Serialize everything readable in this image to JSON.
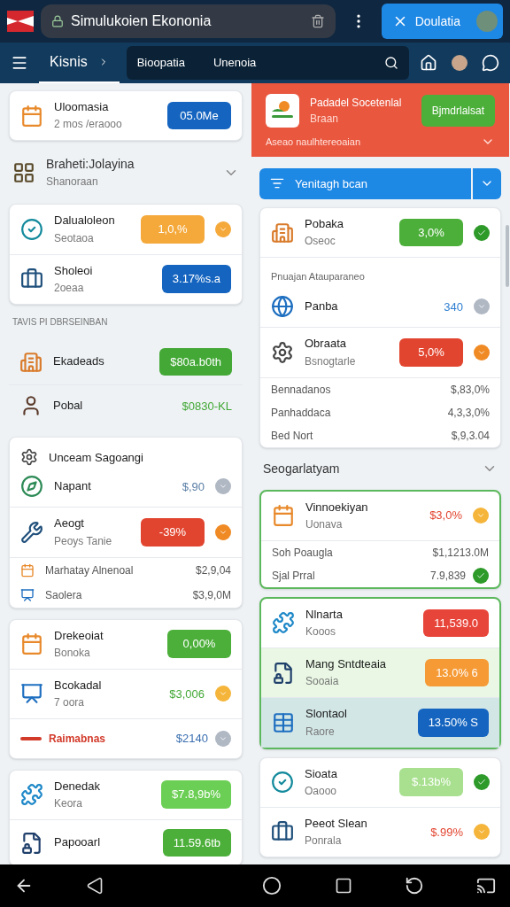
{
  "browser": {
    "title": "Simulukoien Ekononia",
    "action": "Doulatia"
  },
  "nav": {
    "tab": {
      "label": "Kisnis",
      "selected": true
    },
    "search": [
      "Bioopatia",
      "Unenoia"
    ]
  },
  "left": [
    {
      "kind": "card",
      "outlined": false,
      "rows": [
        {
          "kind": "pill",
          "title": "Uloomasia",
          "subtitle": "2 mos /eraooo",
          "value": "05.0Me",
          "color": "#1565c0"
        }
      ]
    },
    {
      "kind": "section",
      "title": "Braheti:Jolayina",
      "subtitle": "Shanoraan"
    },
    {
      "kind": "card",
      "outlined": false,
      "rows": [
        {
          "kind": "pill",
          "title": "Dalualoleon",
          "subtitle": "Seotaoa",
          "value": "1,0,%",
          "color": "#f5a93b",
          "dot": {
            "color": "#f5a93b",
            "check": false
          }
        },
        {
          "kind": "pill",
          "title": "Sholeoi",
          "subtitle": "2oeaa",
          "value": "3.17%s.a",
          "color": "#1565c0"
        }
      ]
    },
    {
      "kind": "label",
      "text": "TAVIS PI DBRSEINBAN"
    },
    {
      "kind": "plain",
      "rows": [
        {
          "kind": "pill",
          "title": "Ekadeads",
          "value": "$80a.b0th",
          "color": "#43a836"
        },
        {
          "kind": "amount",
          "title": "Pobal",
          "value": "$0830-KL",
          "color": "#43a836"
        }
      ]
    },
    {
      "kind": "card",
      "outlined": false,
      "rows": [
        {
          "kind": "heading",
          "title": "Unceam Sagoangi"
        },
        {
          "kind": "amount",
          "title": "Napant",
          "value": "$,90",
          "color": "#5b7fa6",
          "dot": {
            "color": "#b0b8c4",
            "check": false
          }
        },
        {
          "kind": "pill",
          "title": "Aeogt",
          "subtitle": "Peoys Tanie",
          "value": "-39%",
          "color": "#e2452f",
          "dot": {
            "color": "#f08a24",
            "check": false
          }
        },
        {
          "kind": "entry",
          "title": "Marhatay Alnenoal",
          "value": "$2,9,04"
        },
        {
          "kind": "entry",
          "title": "Saolera",
          "value": "$3,9,0M"
        }
      ]
    },
    {
      "kind": "card",
      "outlined": false,
      "rows": [
        {
          "kind": "pill",
          "title": "Drekeoiat",
          "subtitle": "Bonoka",
          "value": "0,00%",
          "color": "#4caf3a"
        },
        {
          "kind": "amount",
          "title": "Bcokadal",
          "subtitle": "7 oora",
          "value": "$3,006",
          "color": "#43a836",
          "dot": {
            "color": "#f5b53b",
            "check": false
          }
        },
        {
          "kind": "alert",
          "title": "Raimabnas",
          "value": "$2140",
          "color": "#3a6fb0",
          "dot": {
            "color": "#b0b8c4",
            "check": false
          }
        }
      ]
    },
    {
      "kind": "card",
      "outlined": false,
      "rows": [
        {
          "kind": "pill",
          "title": "Denedak",
          "subtitle": "Keora",
          "value": "$7.8,9b%",
          "color": "#6ccf55"
        },
        {
          "kind": "pill",
          "title": "Papooarl",
          "value": "11.59.6tb",
          "color": "#4caf3a"
        }
      ]
    }
  ],
  "right": [
    {
      "kind": "banner",
      "title": "Padadel Socetenlal",
      "subtitle": "Braan",
      "button": "Bjmdrlalsat",
      "note": "Aseao naulhtereoaian"
    },
    {
      "kind": "select",
      "label": "Yenitagh bcan"
    },
    {
      "kind": "card",
      "outlined": false,
      "rows": [
        {
          "kind": "pill",
          "title": "Pobaka",
          "subtitle": "Oseoc",
          "value": "3,0%",
          "color": "#4caf3a",
          "dot": {
            "color": "#2e9a2a",
            "check": true
          }
        },
        {
          "kind": "caption",
          "title": "Pnuajan Atauparaneo"
        },
        {
          "kind": "amount",
          "title": "Panba",
          "value": "340",
          "color": "#2f7fd0",
          "dot": {
            "color": "#b0b8c4",
            "check": false
          }
        },
        {
          "kind": "pill",
          "title": "Obraata",
          "subtitle": "Bsnogtarle",
          "value": "5,0%",
          "color": "#e2452f",
          "dot": {
            "color": "#f08a24",
            "check": false
          }
        },
        {
          "kind": "line",
          "title": "Bennadanos",
          "value": "$,83,0%"
        },
        {
          "kind": "line",
          "title": "Panhaddaca",
          "value": "4,3,3,0%"
        },
        {
          "kind": "line",
          "title": "Bed Nort",
          "value": "$,9,3.04"
        }
      ]
    },
    {
      "kind": "section",
      "title": "Seogarlatyam"
    },
    {
      "kind": "card",
      "outlined": true,
      "rows": [
        {
          "kind": "amount",
          "title": "Vinnoekiyan",
          "subtitle": "Uonava",
          "value": "$3,0%",
          "color": "#e2452f",
          "dot": {
            "color": "#f5b53b",
            "check": false
          }
        },
        {
          "kind": "line",
          "title": "Soh Poaugla",
          "value": "$1,1213.0M"
        },
        {
          "kind": "line",
          "title": "Sjal Prral",
          "value": "7.9,839",
          "dot": {
            "color": "#2e9a2a",
            "check": true
          }
        }
      ]
    },
    {
      "kind": "card",
      "outlined": true,
      "rows": [
        {
          "kind": "pill",
          "title": "Nlnarta",
          "subtitle": "Kooos",
          "value": "11,539.0",
          "color": "#e8453a"
        },
        {
          "kind": "pill",
          "title": "Mang Sntdteaia",
          "subtitle": "Sooaia",
          "value": "13.0% 6",
          "color": "#f59a35",
          "highlight": {
            "color": "#e9f7e4"
          }
        },
        {
          "kind": "pill",
          "title": "Slontaol",
          "subtitle": "Raore",
          "value": "13.50% S",
          "color": "#1565c0",
          "highlight": {
            "color": "#d3e6e6"
          }
        }
      ]
    },
    {
      "kind": "card",
      "outlined": false,
      "rows": [
        {
          "kind": "pill",
          "title": "Sioata",
          "subtitle": "Oaooo",
          "value": "$.13b%",
          "color": "#a8e08f",
          "dot": {
            "color": "#2e9a2a",
            "check": true
          }
        },
        {
          "kind": "amount",
          "title": "Peeot Slean",
          "subtitle": "Ponrala",
          "value": "$.99%",
          "color": "#e2452f",
          "dot": {
            "color": "#f5b53b",
            "check": false
          }
        }
      ]
    }
  ]
}
